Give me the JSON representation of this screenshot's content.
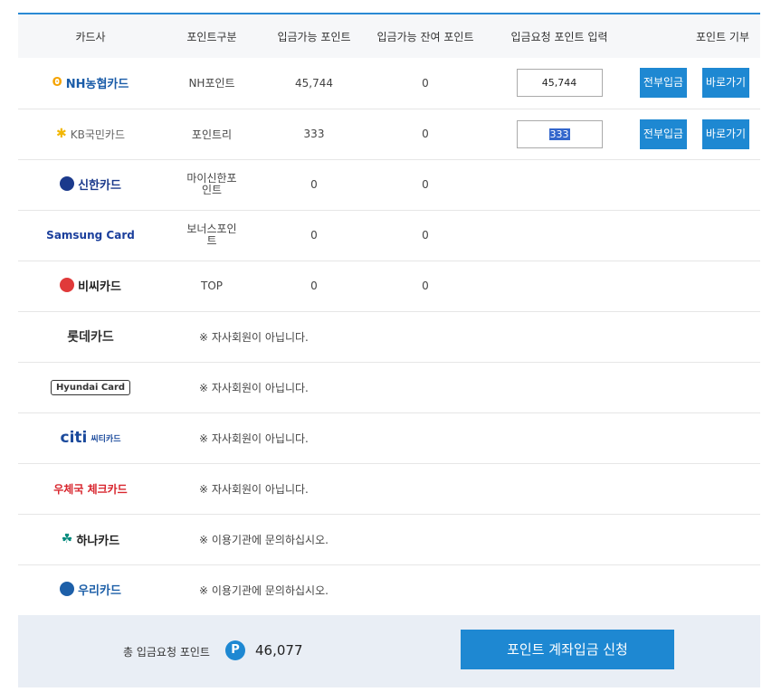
{
  "header": {
    "card_company": "카드사",
    "point_type": "포인트구분",
    "available": "입금가능 포인트",
    "remaining": "입금가능 잔여 포인트",
    "request_input": "입금요청 포인트 입력",
    "donate": "포인트 기부"
  },
  "rows": [
    {
      "logo_text": "NH농협카드",
      "point_type": "NH포인트",
      "available": "45,744",
      "remaining": "0",
      "input_value": "45,744",
      "deposit_all": "전부입금",
      "go": "바로가기",
      "logo_color": "#1a5ca8"
    },
    {
      "logo_text": "KB국민카드",
      "point_type": "포인트리",
      "available": "333",
      "remaining": "0",
      "input_value": "333",
      "deposit_all": "전부입금",
      "go": "바로가기",
      "logo_color": "#666666"
    },
    {
      "logo_text": "신한카드",
      "point_type": "마이신한포인트",
      "available": "0",
      "remaining": "0",
      "logo_color": "#1b3a8c"
    },
    {
      "logo_text": "Samsung Card",
      "point_type": "보너스포인트",
      "available": "0",
      "remaining": "0",
      "logo_color": "#1b3f9c"
    },
    {
      "logo_text": "비씨카드",
      "point_type": "TOP",
      "available": "0",
      "remaining": "0",
      "logo_color": "#222222"
    }
  ],
  "notice_rows": [
    {
      "logo_text": "롯데카드",
      "notice": "※ 자사회원이 아닙니다.",
      "logo_color": "#333333"
    },
    {
      "logo_text": "Hyundai Card",
      "notice": "※ 자사회원이 아닙니다.",
      "logo_color": "#333333"
    },
    {
      "logo_text": "citi",
      "logo_sub": "씨티카드",
      "notice": "※ 자사회원이 아닙니다.",
      "logo_color": "#1b4a9c"
    },
    {
      "logo_text": "우체국 체크카드",
      "notice": "※ 자사회원이 아닙니다.",
      "logo_color": "#d8262e"
    },
    {
      "logo_text": "하나카드",
      "notice": "※ 이용기관에 문의하십시오.",
      "logo_color": "#222222"
    },
    {
      "logo_text": "우리카드",
      "notice": "※ 이용기관에 문의하십시오.",
      "logo_color": "#1d5fa8"
    }
  ],
  "footer": {
    "total_label": "총 입금요청 포인트",
    "badge": "P",
    "total_value": "46,077",
    "submit_label": "포인트 계좌입금 신청"
  },
  "colors": {
    "accent": "#1e88d2",
    "footer_bg": "#e9eef5"
  }
}
